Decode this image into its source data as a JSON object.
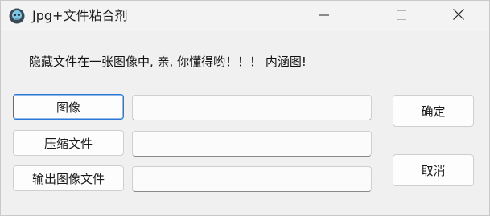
{
  "window": {
    "title": "Jpg+文件粘合剂"
  },
  "description": "隐藏文件在一张图像中, 亲, 你懂得哟！！！ 内涵图!",
  "rows": [
    {
      "button_label": "图像",
      "field_value": ""
    },
    {
      "button_label": "压缩文件",
      "field_value": ""
    },
    {
      "button_label": "输出图像文件",
      "field_value": ""
    }
  ],
  "actions": {
    "ok_label": "确定",
    "cancel_label": "取消"
  },
  "icons": {
    "app": "skull-icon",
    "minimize": "minimize-icon",
    "maximize": "maximize-icon",
    "close": "close-icon"
  },
  "colors": {
    "focus_border": "#2b79d6",
    "background": "#f0f0f0"
  }
}
